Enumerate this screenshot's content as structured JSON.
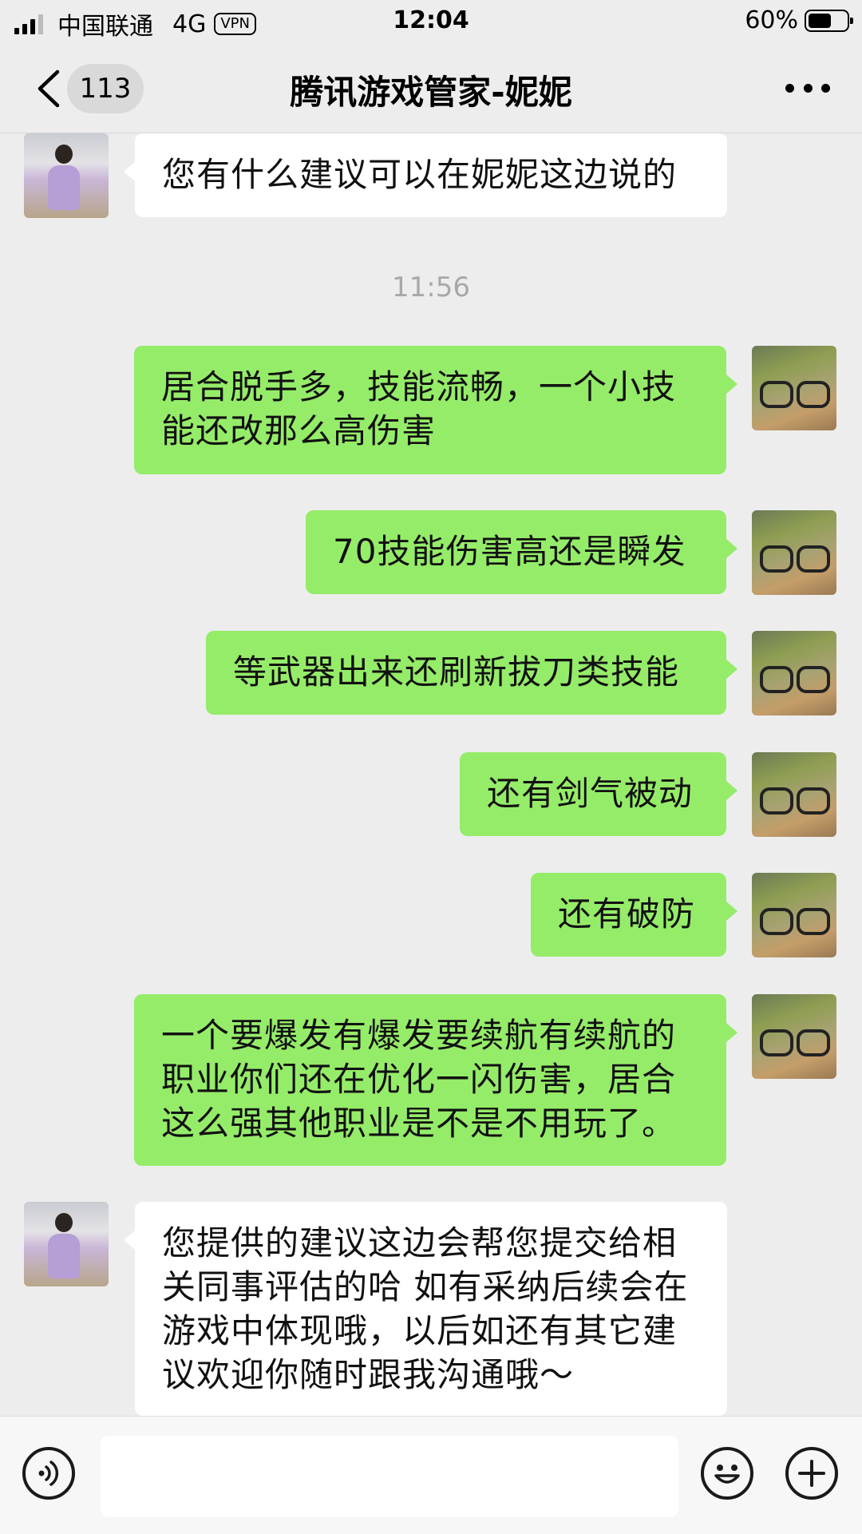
{
  "status_bar": {
    "carrier": "中国联通",
    "network": "4G",
    "vpn": "VPN",
    "time": "12:04",
    "battery_text": "60%",
    "battery_level": 0.6
  },
  "nav": {
    "unread_count": "113",
    "title": "腾讯游戏管家-妮妮"
  },
  "messages": [
    {
      "side": "left",
      "text": "您有什么建议可以在妮妮这边说的"
    },
    {
      "timestamp": "11:56"
    },
    {
      "side": "right",
      "text": "居合脱手多，技能流畅，一个小技能还改那么高伤害"
    },
    {
      "side": "right",
      "text": "70技能伤害高还是瞬发"
    },
    {
      "side": "right",
      "text": "等武器出来还刷新拔刀类技能"
    },
    {
      "side": "right",
      "text": "还有剑气被动"
    },
    {
      "side": "right",
      "text": "还有破防"
    },
    {
      "side": "right",
      "text": "一个要爆发有爆发要续航有续航的职业你们还在优化一闪伤害，居合这么强其他职业是不是不用玩了。"
    },
    {
      "side": "left",
      "text": "您提供的建议这边会帮您提交给相关同事评估的哈 如有采纳后续会在游戏中体现哦，以后如还有其它建议欢迎你随时跟我沟通哦～"
    }
  ],
  "input": {
    "value": "",
    "placeholder": ""
  },
  "colors": {
    "outgoing_bubble": "#95ec69",
    "incoming_bubble": "#ffffff",
    "background": "#ededed"
  }
}
